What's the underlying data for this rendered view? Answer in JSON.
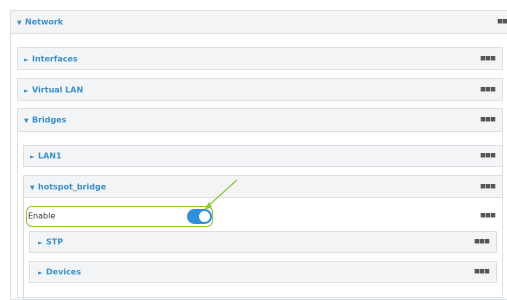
{
  "network": {
    "label": "Network",
    "expanded": true
  },
  "interfaces": {
    "label": "Interfaces",
    "expanded": false
  },
  "virtual_lan": {
    "label": "Virtual LAN",
    "expanded": false
  },
  "bridges": {
    "label": "Bridges",
    "expanded": true
  },
  "lan1": {
    "label": "LAN1",
    "expanded": false
  },
  "hotspot_bridge": {
    "label": "hotspot_bridge",
    "expanded": true
  },
  "enable": {
    "label": "Enable",
    "value": "on"
  },
  "stp": {
    "label": "STP",
    "expanded": false
  },
  "devices": {
    "label": "Devices",
    "expanded": false
  },
  "glyphs": {
    "collapsed": "►",
    "expanded": "▼",
    "menu": "▪▪▪"
  },
  "colors": {
    "accent": "#3b8fcf",
    "toggle_on": "#2f8fd8",
    "highlight": "#8dc63f",
    "header_bg": "#f3f4f6",
    "border": "#dcdfe3"
  }
}
